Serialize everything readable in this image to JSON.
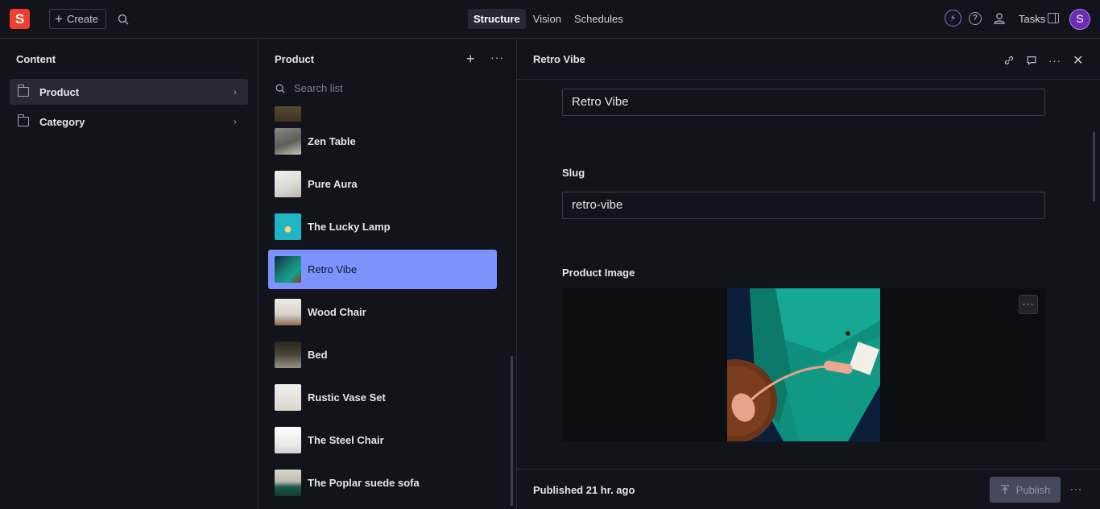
{
  "topbar": {
    "logo_letter": "S",
    "create_label": "Create",
    "nav_tabs": [
      "Structure",
      "Vision",
      "Schedules"
    ],
    "tasks_label": "Tasks",
    "avatar_letter": "S"
  },
  "content_pane": {
    "title": "Content",
    "items": [
      {
        "label": "Product",
        "selected": true
      },
      {
        "label": "Category",
        "selected": false
      }
    ]
  },
  "product_pane": {
    "title": "Product",
    "search_placeholder": "Search list",
    "items": [
      {
        "label": "Zen Table",
        "selected": false
      },
      {
        "label": "Pure Aura",
        "selected": false
      },
      {
        "label": "The Lucky Lamp",
        "selected": false
      },
      {
        "label": "Retro Vibe",
        "selected": true
      },
      {
        "label": "Wood Chair",
        "selected": false
      },
      {
        "label": "Bed",
        "selected": false
      },
      {
        "label": "Rustic Vase Set",
        "selected": false
      },
      {
        "label": "The Steel Chair",
        "selected": false
      },
      {
        "label": "The Poplar suede sofa",
        "selected": false
      }
    ]
  },
  "document": {
    "title": "Retro Vibe",
    "name_value": "Retro Vibe",
    "slug_label": "Slug",
    "slug_value": "retro-vibe",
    "image_label": "Product Image",
    "status": "Published 21 hr. ago",
    "publish_label": "Publish"
  },
  "colors": {
    "accent": "#7c93ff",
    "brand": "#f03e2f",
    "background": "#13141b"
  }
}
